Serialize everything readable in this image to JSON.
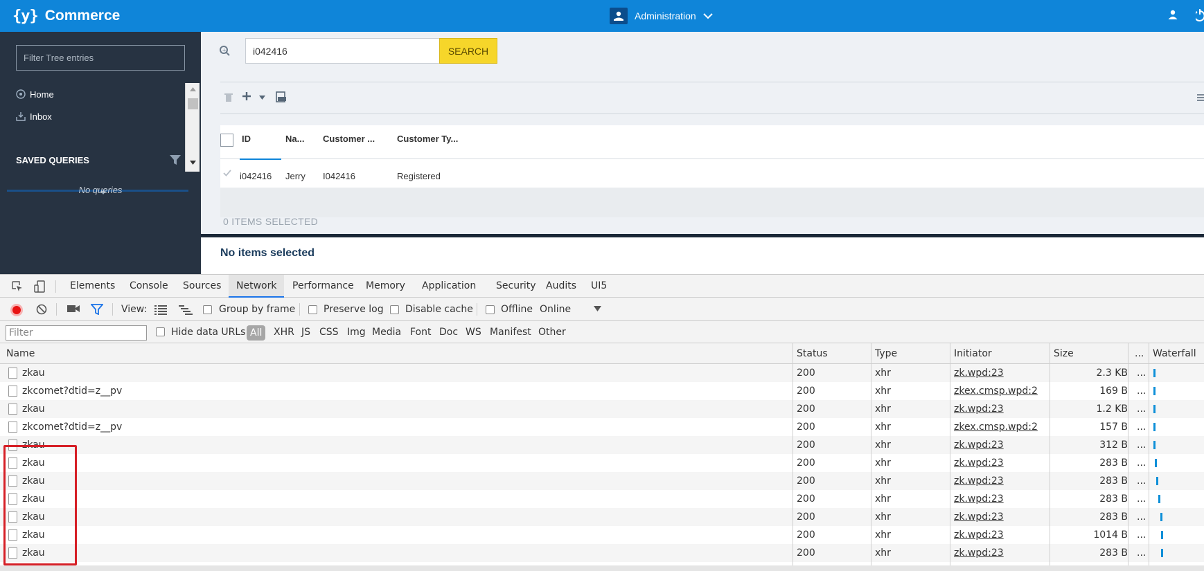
{
  "app": {
    "logo_mark": "{y}",
    "title": "Commerce",
    "perspective": "Administration",
    "brand_color": "#0f85d9"
  },
  "sidebar": {
    "filter_placeholder": "Filter Tree entries",
    "items": [
      {
        "label": "Home",
        "icon": "home-icon"
      },
      {
        "label": "Inbox",
        "icon": "inbox-icon"
      }
    ],
    "saved_queries_title": "SAVED QUERIES",
    "no_queries": "No queries"
  },
  "search": {
    "value": "i042416",
    "button": "SEARCH"
  },
  "grid": {
    "columns": [
      "ID",
      "Na...",
      "Customer ...",
      "Customer Ty..."
    ],
    "rows": [
      {
        "id": "i042416",
        "name": "Jerry",
        "customer": "I042416",
        "type": "Registered"
      }
    ],
    "items_selected": "0 ITEMS SELECTED",
    "no_items": "No items selected"
  },
  "devtools": {
    "tabs": [
      "Elements",
      "Console",
      "Sources",
      "Network",
      "Performance",
      "Memory",
      "Application",
      "Security",
      "Audits",
      "UI5"
    ],
    "active_tab": "Network",
    "toolbar": {
      "view_label": "View:",
      "group_by_frame": "Group by frame",
      "preserve_log": "Preserve log",
      "disable_cache": "Disable cache",
      "offline": "Offline",
      "throttle": "Online"
    },
    "filter_placeholder": "Filter",
    "hide_data_urls": "Hide data URLs",
    "types": [
      "All",
      "XHR",
      "JS",
      "CSS",
      "Img",
      "Media",
      "Font",
      "Doc",
      "WS",
      "Manifest",
      "Other"
    ],
    "columns": [
      "Name",
      "Status",
      "Type",
      "Initiator",
      "Size",
      "...",
      "Waterfall"
    ],
    "requests": [
      {
        "name": "zkau",
        "status": "200",
        "type": "xhr",
        "initiator": "zk.wpd:23",
        "size": "2.3 KB",
        "more": "...",
        "wf": 0.02
      },
      {
        "name": "zkcomet?dtid=z__pv",
        "status": "200",
        "type": "xhr",
        "initiator": "zkex.cmsp.wpd:2",
        "size": "169 B",
        "more": "...",
        "wf": 0.03
      },
      {
        "name": "zkau",
        "status": "200",
        "type": "xhr",
        "initiator": "zk.wpd:23",
        "size": "1.2 KB",
        "more": "...",
        "wf": 0.03
      },
      {
        "name": "zkcomet?dtid=z__pv",
        "status": "200",
        "type": "xhr",
        "initiator": "zkex.cmsp.wpd:2",
        "size": "157 B",
        "more": "...",
        "wf": 0.03
      },
      {
        "name": "zkau",
        "status": "200",
        "type": "xhr",
        "initiator": "zk.wpd:23",
        "size": "312 B",
        "more": "...",
        "wf": 0.03
      },
      {
        "name": "zkau",
        "status": "200",
        "type": "xhr",
        "initiator": "zk.wpd:23",
        "size": "283 B",
        "more": "...",
        "wf": 0.05
      },
      {
        "name": "zkau",
        "status": "200",
        "type": "xhr",
        "initiator": "zk.wpd:23",
        "size": "283 B",
        "more": "...",
        "wf": 0.08
      },
      {
        "name": "zkau",
        "status": "200",
        "type": "xhr",
        "initiator": "zk.wpd:23",
        "size": "283 B",
        "more": "...",
        "wf": 0.12
      },
      {
        "name": "zkau",
        "status": "200",
        "type": "xhr",
        "initiator": "zk.wpd:23",
        "size": "283 B",
        "more": "...",
        "wf": 0.16
      },
      {
        "name": "zkau",
        "status": "200",
        "type": "xhr",
        "initiator": "zk.wpd:23",
        "size": "1014 B",
        "more": "...",
        "wf": 0.17
      },
      {
        "name": "zkau",
        "status": "200",
        "type": "xhr",
        "initiator": "zk.wpd:23",
        "size": "283 B",
        "more": "...",
        "wf": 0.17
      }
    ]
  }
}
